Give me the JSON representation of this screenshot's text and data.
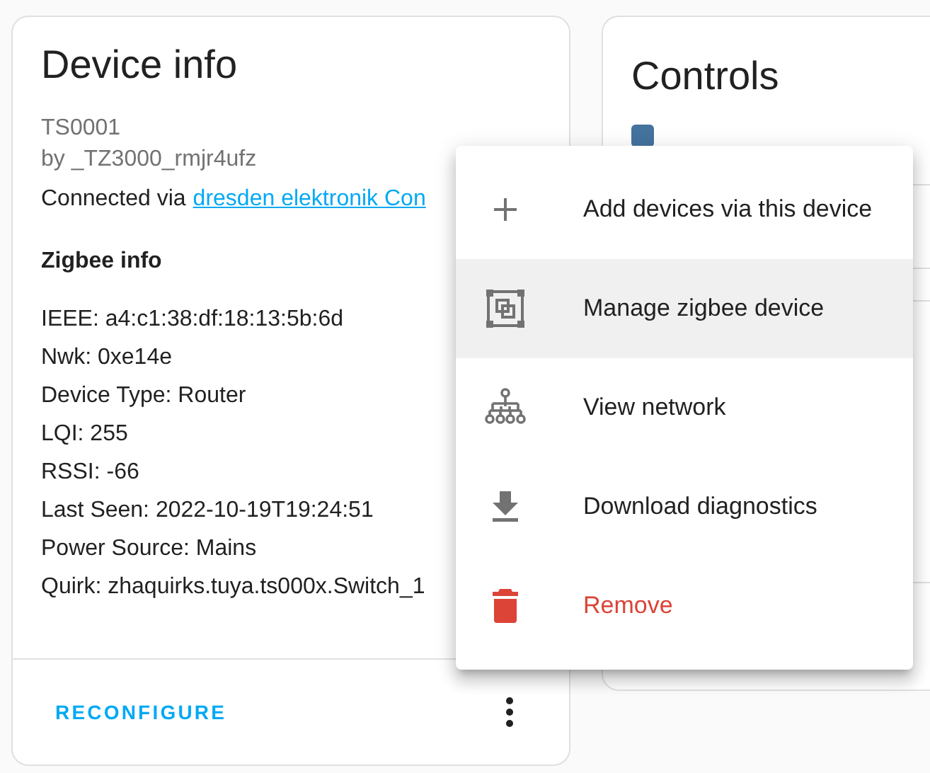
{
  "device_card": {
    "title": "Device info",
    "model": "TS0001",
    "manufacturer": "by _TZ3000_rmjr4ufz",
    "connected_prefix": "Connected via",
    "connected_link": "dresden elektronik Con",
    "section_title": "Zigbee info",
    "info_rows": [
      "IEEE: a4:c1:38:df:18:13:5b:6d",
      "Nwk: 0xe14e",
      "Device Type: Router",
      "LQI: 255",
      "RSSI: -66",
      "Last Seen: 2022-10-19T19:24:51",
      "Power Source: Mains",
      "Quirk: zhaquirks.tuya.ts000x.Switch_1"
    ],
    "action_button": "RECONFIGURE"
  },
  "controls_card": {
    "title": "Controls"
  },
  "menu": {
    "items": [
      {
        "label": "Add devices via this device",
        "kind": "normal",
        "selected": false
      },
      {
        "label": "Manage zigbee device",
        "kind": "normal",
        "selected": true
      },
      {
        "label": "View network",
        "kind": "normal",
        "selected": false
      },
      {
        "label": "Download diagnostics",
        "kind": "normal",
        "selected": false
      },
      {
        "label": "Remove",
        "kind": "danger",
        "selected": false
      }
    ]
  }
}
